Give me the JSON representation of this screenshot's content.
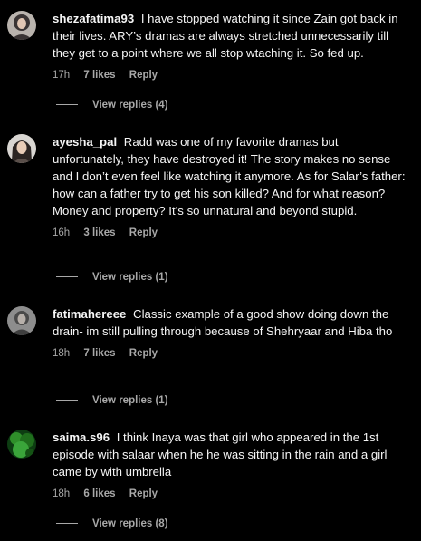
{
  "comments": [
    {
      "username": "shezafatima93",
      "text": "I have stopped watching it since Zain got back in their lives. ARY’s dramas are always stretched unnecessarily till they get to a point where we all stop wtaching it. So fed up.",
      "time": "17h",
      "likes": "7 likes",
      "reply": "Reply",
      "view_replies": "View replies (4)",
      "avatar_icon": "profile-photo-woman-hijab"
    },
    {
      "username": "ayesha_pal",
      "text": "Radd was one of my favorite dramas but unfortunately, they have destroyed it! The story makes no sense and I don’t even feel like watching it anymore. As for Salar’s father: how can a father try to get his son killed? And for what reason? Money and property? It’s so unnatural and beyond stupid.",
      "time": "16h",
      "likes": "3 likes",
      "reply": "Reply",
      "view_replies": "View replies (1)",
      "avatar_icon": "profile-photo-woman"
    },
    {
      "username": "fatimahereee",
      "text": "Classic example of a good show doing down the drain- im still pulling through because of Shehryaar and Hiba tho",
      "time": "18h",
      "likes": "7 likes",
      "reply": "Reply",
      "view_replies": "View replies (1)",
      "avatar_icon": "profile-photo-grey"
    },
    {
      "username": "saima.s96",
      "text": "I think Inaya was that girl who appeared in the 1st episode with salaar when he he was sitting in the rain and a girl came by with umbrella",
      "time": "18h",
      "likes": "6 likes",
      "reply": "Reply",
      "view_replies": "View replies (8)",
      "avatar_icon": "profile-photo-green"
    }
  ],
  "colors": {
    "background": "#000000",
    "text": "#f5f5f5",
    "secondary": "#a8a8a8"
  }
}
